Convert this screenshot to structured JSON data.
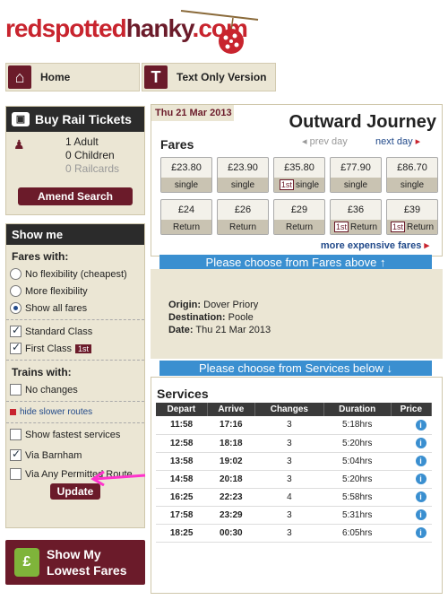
{
  "logo": {
    "part1": "redspotted",
    "part2": "hanky",
    "part3": ".com"
  },
  "nav": {
    "home_label": "Home",
    "text_only_label": "Text Only Version",
    "home_icon": "house-icon",
    "text_icon": "T"
  },
  "rail": {
    "title": "Buy Rail Tickets",
    "adult": "1 Adult",
    "children": "0 Children",
    "railcards": "0 Railcards",
    "amend_label": "Amend Search"
  },
  "showme": {
    "title": "Show me",
    "fares_with_label": "Fares with:",
    "fare_options": [
      "No flexibility (cheapest)",
      "More flexibility",
      "Show all fares"
    ],
    "selected_fare_option": 2,
    "standard_class": "Standard Class",
    "first_class": "First Class",
    "first_badge": "1st",
    "trains_with_label": "Trains with:",
    "no_changes": "No changes",
    "hide_slower": "hide slower routes",
    "show_fastest": "Show fastest services",
    "via_barnham": "Via Barnham",
    "via_any": "Via Any Permitted Route",
    "update_label": "Update"
  },
  "promo": {
    "line1": "Show My",
    "line2": "Lowest Fares"
  },
  "journey": {
    "date": "Thu 21 Mar 2013",
    "title": "Outward Journey",
    "fares_label": "Fares",
    "prev_day": "prev day",
    "next_day": "next day",
    "more_fares": "more expensive fares",
    "choose_fares": "Please choose from Fares above",
    "choose_services": "Please choose from Services below"
  },
  "fares": [
    {
      "price": "£23.80",
      "type": "single",
      "first": false
    },
    {
      "price": "£23.90",
      "type": "single",
      "first": false
    },
    {
      "price": "£35.80",
      "type": "single",
      "first": true
    },
    {
      "price": "£77.90",
      "type": "single",
      "first": false
    },
    {
      "price": "£86.70",
      "type": "single",
      "first": false
    },
    {
      "price": "£24",
      "type": "Return",
      "first": false
    },
    {
      "price": "£26",
      "type": "Return",
      "first": false
    },
    {
      "price": "£29",
      "type": "Return",
      "first": false
    },
    {
      "price": "£36",
      "type": "Return",
      "first": true
    },
    {
      "price": "£39",
      "type": "Return",
      "first": true
    }
  ],
  "details": {
    "origin_label": "Origin:",
    "origin": "Dover Priory",
    "destination_label": "Destination:",
    "destination": "Poole",
    "date_label": "Date:",
    "date": "Thu 21 Mar 2013"
  },
  "services": {
    "title": "Services",
    "columns": [
      "Depart",
      "Arrive",
      "Changes",
      "Duration",
      "Price"
    ],
    "rows": [
      [
        "11:58",
        "17:16",
        "3",
        "5:18hrs"
      ],
      [
        "12:58",
        "18:18",
        "3",
        "5:20hrs"
      ],
      [
        "13:58",
        "19:02",
        "3",
        "5:04hrs"
      ],
      [
        "14:58",
        "20:18",
        "3",
        "5:20hrs"
      ],
      [
        "16:25",
        "22:23",
        "4",
        "5:58hrs"
      ],
      [
        "17:58",
        "23:29",
        "3",
        "5:31hrs"
      ],
      [
        "18:25",
        "00:30",
        "3",
        "6:05hrs"
      ]
    ]
  },
  "colors": {
    "maroon": "#6b1b2a",
    "red": "#c8242e",
    "blue": "#3a8fd0",
    "beige": "#ebe6d4",
    "annotation": "#ff33cc"
  }
}
